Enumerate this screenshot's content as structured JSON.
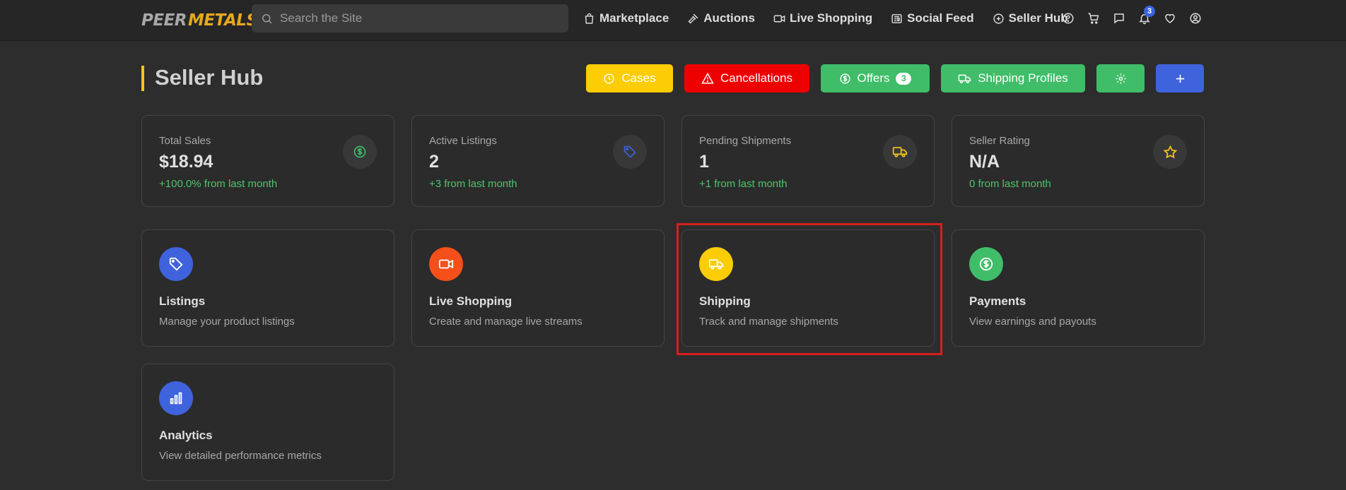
{
  "logo": {
    "part1": "PEER",
    "part2": "METALS"
  },
  "search": {
    "placeholder": "Search the Site"
  },
  "nav": [
    {
      "label": "Marketplace",
      "icon": "shopping-bag-icon"
    },
    {
      "label": "Auctions",
      "icon": "gavel-icon"
    },
    {
      "label": "Live Shopping",
      "icon": "video-icon"
    },
    {
      "label": "Social Feed",
      "icon": "newspaper-icon"
    },
    {
      "label": "Seller Hub",
      "icon": "plus-circle-icon"
    }
  ],
  "nav_icons": {
    "notifications_count": "3"
  },
  "header": {
    "title": "Seller Hub"
  },
  "actions": {
    "cases": "Cases",
    "cancellations": "Cancellations",
    "offers": "Offers",
    "offers_count": "3",
    "shipping_profiles": "Shipping Profiles"
  },
  "stats": [
    {
      "label": "Total Sales",
      "value": "$18.94",
      "change": "+100.0% from last month",
      "icon": "dollar-circle-icon",
      "icon_color": "#3fbd68"
    },
    {
      "label": "Active Listings",
      "value": "2",
      "change": "+3 from last month",
      "icon": "tag-icon",
      "icon_color": "#3f63dc"
    },
    {
      "label": "Pending Shipments",
      "value": "1",
      "change": "+1 from last month",
      "icon": "truck-icon",
      "icon_color": "#f5c816"
    },
    {
      "label": "Seller Rating",
      "value": "N/A",
      "change": "0 from last month",
      "icon": "star-icon",
      "icon_color": "#f5c816"
    }
  ],
  "cards": [
    {
      "title": "Listings",
      "desc": "Manage your product listings",
      "icon": "tag-icon",
      "bg": "#3f63dc"
    },
    {
      "title": "Live Shopping",
      "desc": "Create and manage live streams",
      "icon": "video-icon",
      "bg": "#f5501a"
    },
    {
      "title": "Shipping",
      "desc": "Track and manage shipments",
      "icon": "truck-icon",
      "bg": "#fccc05"
    },
    {
      "title": "Payments",
      "desc": "View earnings and payouts",
      "icon": "dollar-circle-icon",
      "bg": "#3fbd68"
    },
    {
      "title": "Analytics",
      "desc": "View detailed performance metrics",
      "icon": "bar-chart-icon",
      "bg": "#3f63dc"
    }
  ],
  "colors": {
    "background": "#2d2d2d",
    "accent_yellow": "#f5c816",
    "green": "#3fbd68",
    "red": "#ee0000",
    "blue": "#3f63dc",
    "highlight": "#d81f1f"
  }
}
